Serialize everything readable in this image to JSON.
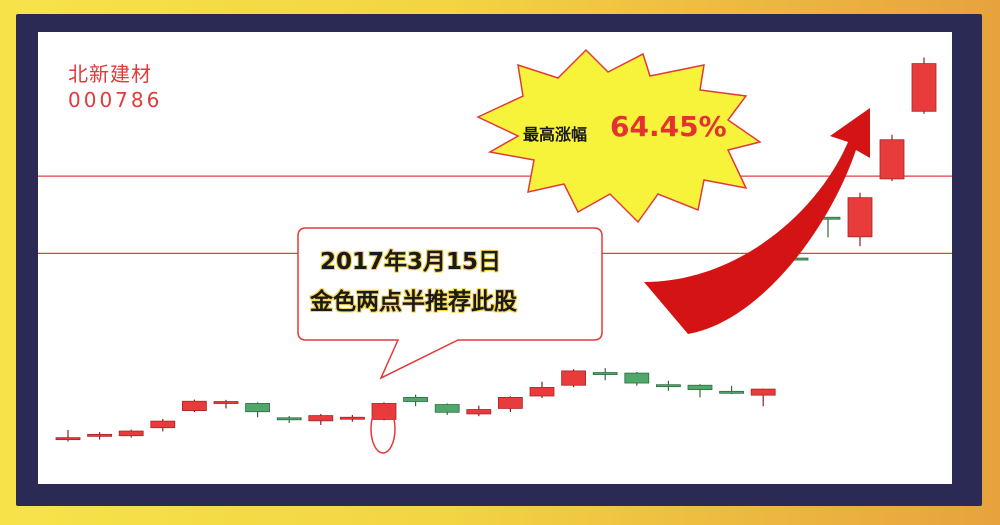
{
  "stock": {
    "name": "北新建材",
    "code": "000786"
  },
  "callout": {
    "date": "2017年3月15日",
    "note": "金色两点半推荐此股"
  },
  "highlight": {
    "label": "最高涨幅",
    "value": "64.45%"
  },
  "colors": {
    "up": "#e83b3b",
    "down": "#4fa86a",
    "line": "#e04040",
    "arrow": "#d41414",
    "burst": "#f7f33a",
    "frame": "#2a2a55"
  },
  "chart_data": {
    "type": "candlestick",
    "note": "relative price levels (unlabeled axis), one candle per trading day",
    "reference_lines": [
      100,
      72
    ],
    "candles": [
      {
        "o": 5.0,
        "c": 5.2,
        "h": 8.0,
        "l": 3.8
      },
      {
        "o": 5.8,
        "c": 6.4,
        "h": 7.2,
        "l": 4.5
      },
      {
        "o": 5.9,
        "c": 7.6,
        "h": 8.1,
        "l": 5.2
      },
      {
        "o": 8.8,
        "c": 11.2,
        "h": 12.0,
        "l": 7.5
      },
      {
        "o": 15.0,
        "c": 18.4,
        "h": 19.0,
        "l": 14.5
      },
      {
        "o": 18.0,
        "c": 18.3,
        "h": 18.9,
        "l": 15.8
      },
      {
        "o": 17.6,
        "c": 14.6,
        "h": 18.0,
        "l": 12.6
      },
      {
        "o": 12.4,
        "c": 11.8,
        "h": 13.0,
        "l": 10.5
      },
      {
        "o": 11.3,
        "c": 13.2,
        "h": 13.8,
        "l": 9.8
      },
      {
        "o": 12.4,
        "c": 12.6,
        "h": 13.4,
        "l": 11.0
      },
      {
        "o": 11.8,
        "c": 17.6,
        "h": 18.0,
        "l": 11.5
      },
      {
        "o": 19.8,
        "c": 18.3,
        "h": 20.8,
        "l": 16.6
      },
      {
        "o": 17.2,
        "c": 14.4,
        "h": 17.6,
        "l": 13.4
      },
      {
        "o": 13.8,
        "c": 15.4,
        "h": 16.8,
        "l": 13.0
      },
      {
        "o": 15.8,
        "c": 19.8,
        "h": 20.2,
        "l": 14.5
      },
      {
        "o": 20.3,
        "c": 23.4,
        "h": 25.5,
        "l": 19.6
      },
      {
        "o": 24.2,
        "c": 29.4,
        "h": 30.0,
        "l": 23.5
      },
      {
        "o": 28.8,
        "c": 28.4,
        "h": 30.4,
        "l": 26.0
      },
      {
        "o": 28.6,
        "c": 25.0,
        "h": 29.0,
        "l": 24.0
      },
      {
        "o": 24.4,
        "c": 23.8,
        "h": 25.8,
        "l": 22.2
      },
      {
        "o": 24.2,
        "c": 22.6,
        "h": 24.6,
        "l": 19.8
      },
      {
        "o": 22.0,
        "c": 21.8,
        "h": 24.0,
        "l": 21.0
      },
      {
        "o": 20.6,
        "c": 22.8,
        "h": 23.0,
        "l": 16.6
      }
    ],
    "post_gap_candles": [
      {
        "o": 70.3,
        "c": 70.0,
        "h": 70.3,
        "l": 70.0
      },
      {
        "o": 85.1,
        "c": 84.8,
        "h": 85.1,
        "l": 77.8
      },
      {
        "o": 78.0,
        "c": 92.2,
        "h": 94.0,
        "l": 74.6
      },
      {
        "o": 99.0,
        "c": 113.2,
        "h": 115.0,
        "l": 98.2
      },
      {
        "o": 123.5,
        "c": 140.8,
        "h": 143.0,
        "l": 122.6
      }
    ]
  }
}
